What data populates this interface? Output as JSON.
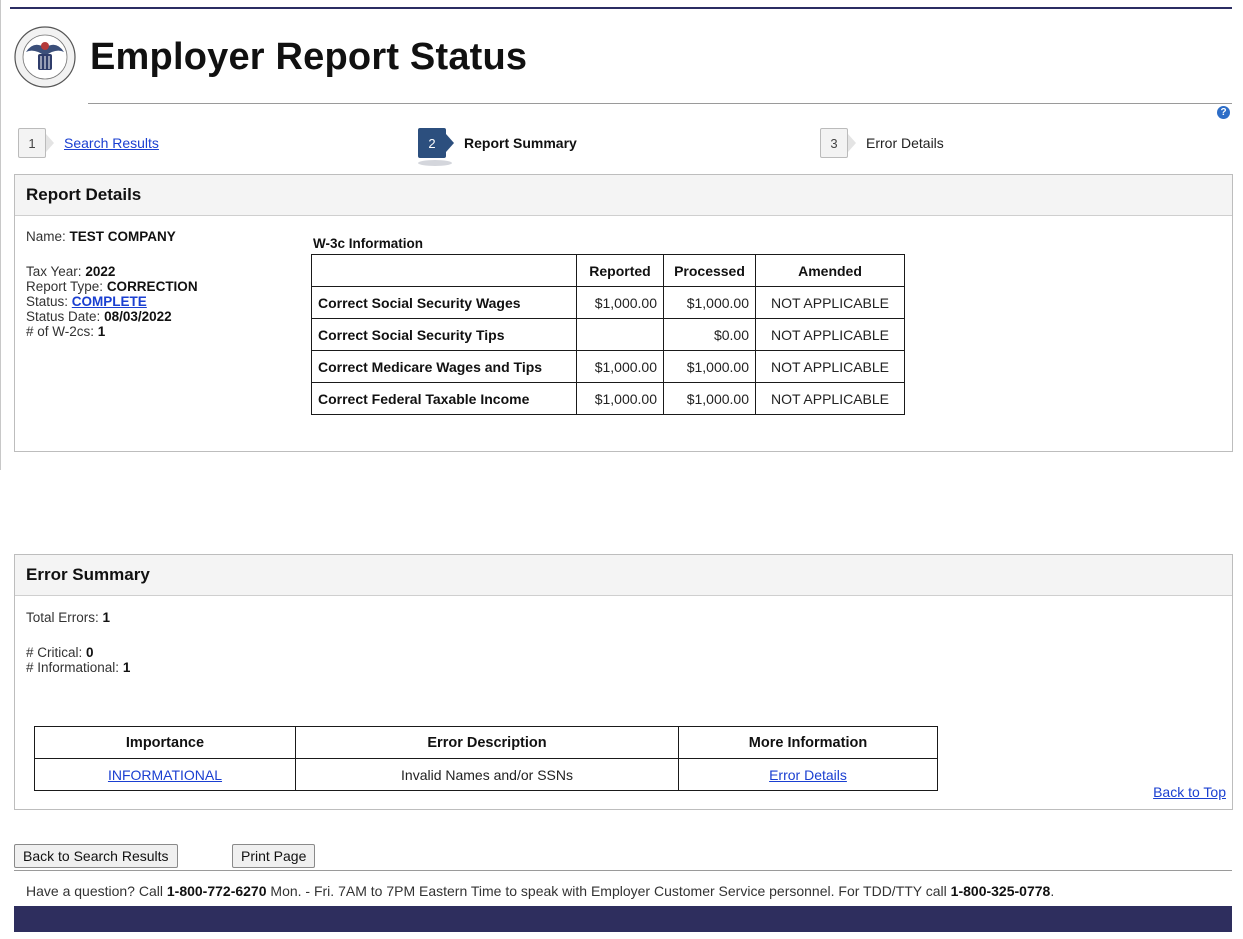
{
  "page": {
    "title": "Employer Report Status"
  },
  "steps": [
    {
      "num": "1",
      "label": "Search Results"
    },
    {
      "num": "2",
      "label": "Report Summary"
    },
    {
      "num": "3",
      "label": "Error Details"
    }
  ],
  "report_details": {
    "heading": "Report Details",
    "name_label": "Name:",
    "name_value": "TEST COMPANY",
    "tax_year_label": "Tax Year:",
    "tax_year_value": "2022",
    "report_type_label": "Report Type:",
    "report_type_value": "CORRECTION",
    "status_label": "Status:",
    "status_value": "COMPLETE",
    "status_date_label": "Status Date:",
    "status_date_value": "08/03/2022",
    "w2cs_label": "# of W-2cs:",
    "w2cs_value": "1"
  },
  "w3c": {
    "title": "W-3c Information",
    "headers": [
      "",
      "Reported",
      "Processed",
      "Amended"
    ],
    "rows": [
      {
        "label": "Correct Social Security Wages",
        "reported": "$1,000.00",
        "processed": "$1,000.00",
        "amended": "NOT APPLICABLE"
      },
      {
        "label": "Correct Social Security Tips",
        "reported": "",
        "processed": "$0.00",
        "amended": "NOT APPLICABLE"
      },
      {
        "label": "Correct Medicare Wages and Tips",
        "reported": "$1,000.00",
        "processed": "$1,000.00",
        "amended": "NOT APPLICABLE"
      },
      {
        "label": "Correct Federal Taxable Income",
        "reported": "$1,000.00",
        "processed": "$1,000.00",
        "amended": "NOT APPLICABLE"
      }
    ]
  },
  "error_summary": {
    "heading": "Error Summary",
    "total_label": "Total Errors:",
    "total_value": "1",
    "critical_label": "# Critical:",
    "critical_value": "0",
    "informational_label": "# Informational:",
    "informational_value": "1",
    "headers": [
      "Importance",
      "Error Description",
      "More Information"
    ],
    "rows": [
      {
        "importance": "INFORMATIONAL",
        "description": "Invalid Names and/or SSNs",
        "more": "Error Details"
      }
    ],
    "back_to_top": "Back to Top"
  },
  "buttons": {
    "back": "Back to Search Results",
    "print": "Print Page"
  },
  "footer": {
    "pre": "Have a question? Call ",
    "phone1": "1-800-772-6270",
    "mid": " Mon. - Fri. 7AM to 7PM Eastern Time to speak with Employer Customer Service personnel. For TDD/TTY call ",
    "phone2": "1-800-325-0778",
    "post": "."
  },
  "help_icon": {
    "glyph": "?"
  }
}
